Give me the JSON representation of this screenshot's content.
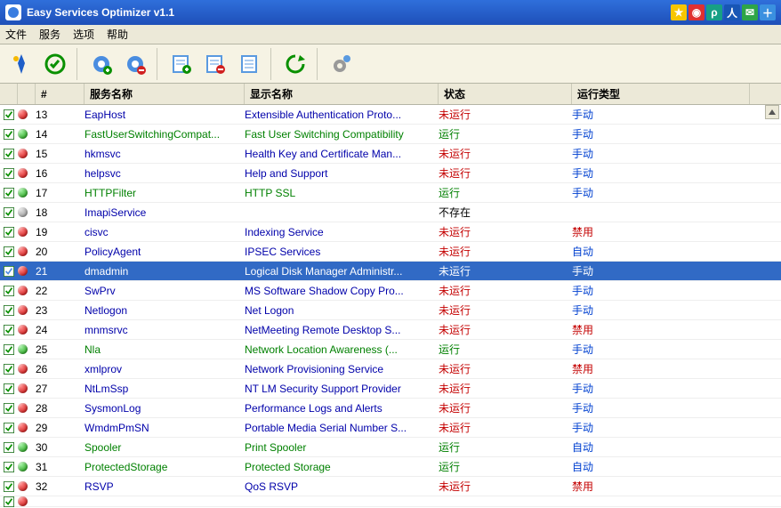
{
  "title": "Easy Services Optimizer v1.1",
  "menu": {
    "file": "文件",
    "service": "服务",
    "option": "选项",
    "help": "帮助"
  },
  "columns": {
    "num": "#",
    "name": "服务名称",
    "display": "显示名称",
    "status": "状态",
    "start": "运行类型"
  },
  "status_labels": {
    "running": "运行",
    "not": "未运行",
    "na": "不存在"
  },
  "start_labels": {
    "manual": "手动",
    "disabled": "禁用",
    "auto": "自动"
  },
  "rows": [
    {
      "n": 13,
      "name": "EapHost",
      "disp": "Extensible Authentication Proto...",
      "status": "not",
      "start": "manual",
      "dot": "red"
    },
    {
      "n": 14,
      "name": "FastUserSwitchingCompat...",
      "disp": "Fast User Switching Compatibility",
      "status": "running",
      "start": "manual",
      "dot": "green"
    },
    {
      "n": 15,
      "name": "hkmsvc",
      "disp": "Health Key and Certificate Man...",
      "status": "not",
      "start": "manual",
      "dot": "red"
    },
    {
      "n": 16,
      "name": "helpsvc",
      "disp": "Help and Support",
      "status": "not",
      "start": "manual",
      "dot": "red"
    },
    {
      "n": 17,
      "name": "HTTPFilter",
      "disp": "HTTP SSL",
      "status": "running",
      "start": "manual",
      "dot": "green"
    },
    {
      "n": 18,
      "name": "ImapiService",
      "disp": "",
      "status": "na",
      "start": "",
      "dot": "gray"
    },
    {
      "n": 19,
      "name": "cisvc",
      "disp": "Indexing Service",
      "status": "not",
      "start": "disabled",
      "dot": "red"
    },
    {
      "n": 20,
      "name": "PolicyAgent",
      "disp": "IPSEC Services",
      "status": "not",
      "start": "auto",
      "dot": "red"
    },
    {
      "n": 21,
      "name": "dmadmin",
      "disp": "Logical Disk Manager Administr...",
      "status": "not",
      "start": "manual",
      "dot": "red",
      "selected": true
    },
    {
      "n": 22,
      "name": "SwPrv",
      "disp": "MS Software Shadow Copy Pro...",
      "status": "not",
      "start": "manual",
      "dot": "red"
    },
    {
      "n": 23,
      "name": "Netlogon",
      "disp": "Net Logon",
      "status": "not",
      "start": "manual",
      "dot": "red"
    },
    {
      "n": 24,
      "name": "mnmsrvc",
      "disp": "NetMeeting Remote Desktop S...",
      "status": "not",
      "start": "disabled",
      "dot": "red"
    },
    {
      "n": 25,
      "name": "Nla",
      "disp": "Network Location Awareness (...",
      "status": "running",
      "start": "manual",
      "dot": "green"
    },
    {
      "n": 26,
      "name": "xmlprov",
      "disp": "Network Provisioning Service",
      "status": "not",
      "start": "disabled",
      "dot": "red"
    },
    {
      "n": 27,
      "name": "NtLmSsp",
      "disp": "NT LM Security Support Provider",
      "status": "not",
      "start": "manual",
      "dot": "red"
    },
    {
      "n": 28,
      "name": "SysmonLog",
      "disp": "Performance Logs and Alerts",
      "status": "not",
      "start": "manual",
      "dot": "red"
    },
    {
      "n": 29,
      "name": "WmdmPmSN",
      "disp": "Portable Media Serial Number S...",
      "status": "not",
      "start": "manual",
      "dot": "red"
    },
    {
      "n": 30,
      "name": "Spooler",
      "disp": "Print Spooler",
      "status": "running",
      "start": "auto",
      "dot": "green"
    },
    {
      "n": 31,
      "name": "ProtectedStorage",
      "disp": "Protected Storage",
      "status": "running",
      "start": "auto",
      "dot": "green"
    },
    {
      "n": 32,
      "name": "RSVP",
      "disp": "QoS RSVP",
      "status": "not",
      "start": "disabled",
      "dot": "red"
    }
  ],
  "tray_icons": [
    "star",
    "weibo",
    "p",
    "person",
    "wechat",
    "plus"
  ]
}
